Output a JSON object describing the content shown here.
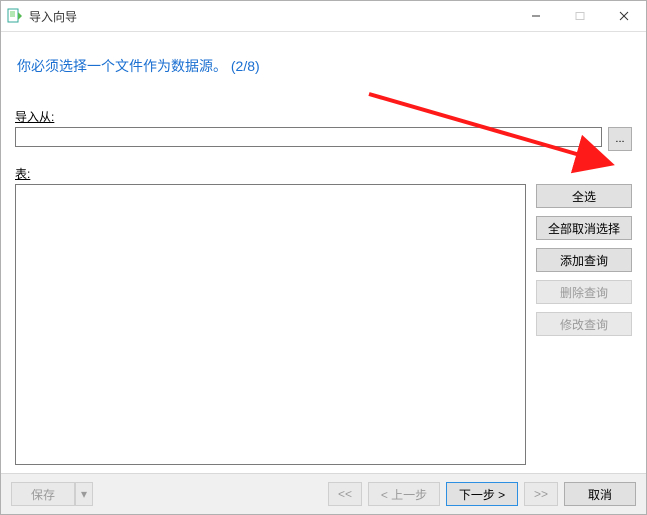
{
  "titlebar": {
    "title": "导入向导"
  },
  "heading": "你必须选择一个文件作为数据源。 (2/8)",
  "labels": {
    "import_from": "导入从:",
    "tables": "表:"
  },
  "inputs": {
    "import_from_value": ""
  },
  "side_buttons": {
    "select_all": "全选",
    "deselect_all": "全部取消选择",
    "add_query": "添加查询",
    "delete_query": "删除查询",
    "modify_query": "修改查询"
  },
  "browse": {
    "label": "..."
  },
  "footer": {
    "save": "保存",
    "save_drop": "▾",
    "first": "<<",
    "prev": "< 上一步",
    "next": "下一步 >",
    "last": ">>",
    "cancel": "取消"
  }
}
